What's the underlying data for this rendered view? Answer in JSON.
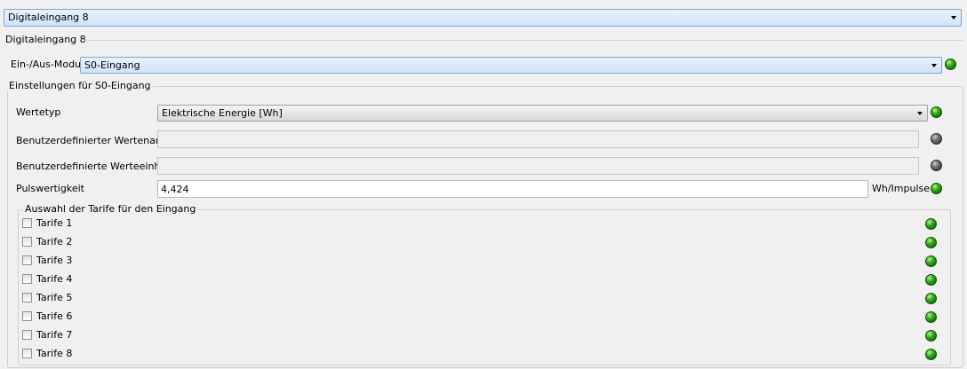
{
  "top_selector": {
    "value": "Digitaleingang 8"
  },
  "section_title": "Digitaleingang 8",
  "mode": {
    "label": "Ein-/Aus-Modus",
    "value": "S0-Eingang",
    "status": "green"
  },
  "settings": {
    "title": "Einstellungen für S0-Eingang",
    "werte_typ": {
      "label": "Wertetyp",
      "value": "Elektrische Energie [Wh]",
      "status": "green"
    },
    "custom_name": {
      "label": "Benutzerdefinierter Wertename",
      "value": "",
      "status": "grey"
    },
    "custom_unit": {
      "label": "Benutzerdefinierte Werteeinheit",
      "value": "",
      "status": "grey"
    },
    "pulse": {
      "label": "Pulswertigkeit",
      "value": "4,424",
      "unit": "Wh/Impulse",
      "status": "green"
    }
  },
  "tariffs": {
    "title": "Auswahl der Tarife für den Eingang",
    "items": [
      {
        "label": "Tarife 1",
        "checked": false,
        "status": "green"
      },
      {
        "label": "Tarife 2",
        "checked": false,
        "status": "green"
      },
      {
        "label": "Tarife 3",
        "checked": false,
        "status": "green"
      },
      {
        "label": "Tarife 4",
        "checked": false,
        "status": "green"
      },
      {
        "label": "Tarife 5",
        "checked": false,
        "status": "green"
      },
      {
        "label": "Tarife 6",
        "checked": false,
        "status": "green"
      },
      {
        "label": "Tarife 7",
        "checked": false,
        "status": "green"
      },
      {
        "label": "Tarife 8",
        "checked": false,
        "status": "green"
      }
    ]
  },
  "colors": {
    "led_green": "#39b21f",
    "led_grey": "#707070",
    "combo_border": "#7aa7d6"
  }
}
